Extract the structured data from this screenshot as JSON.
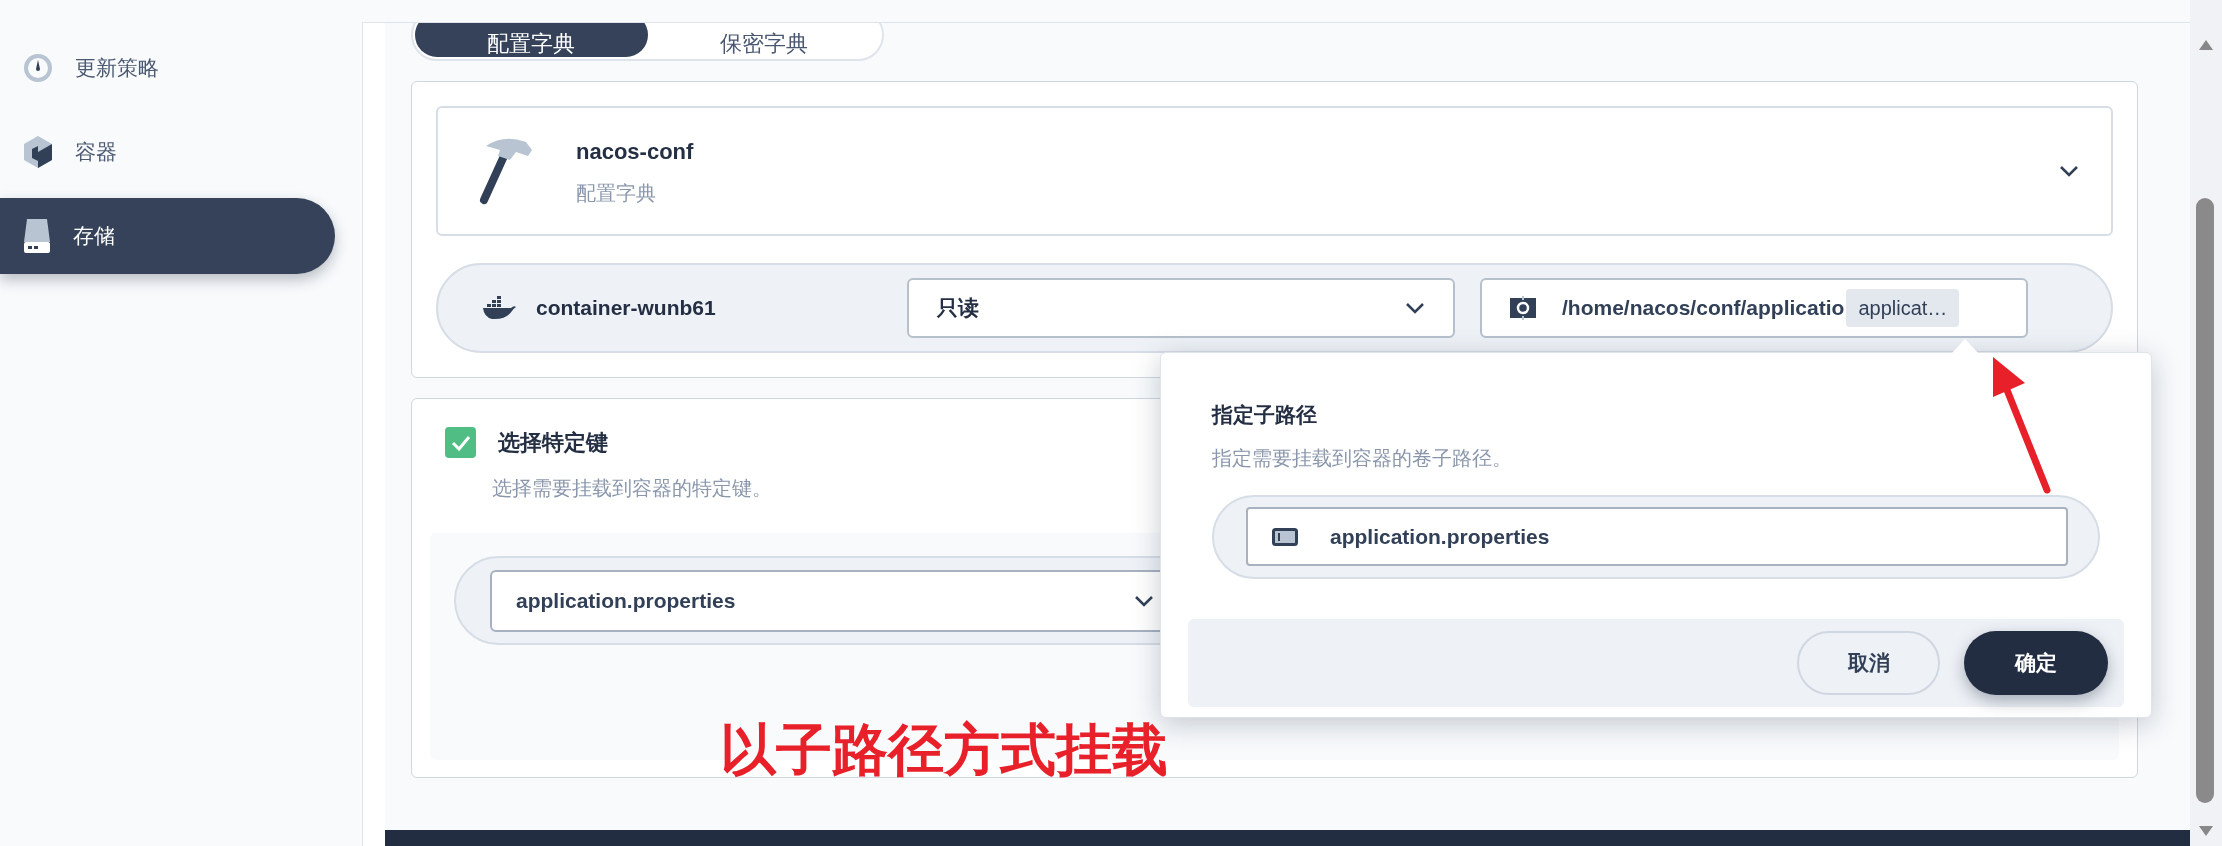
{
  "sidebar": {
    "items": [
      {
        "label": "更新策略",
        "selected": false
      },
      {
        "label": "容器",
        "selected": false
      },
      {
        "label": "存储",
        "selected": true
      }
    ]
  },
  "tabs": [
    {
      "label": "配置字典",
      "selected": true
    },
    {
      "label": "保密字典",
      "selected": false
    }
  ],
  "volume": {
    "name": "nacos-conf",
    "type": "配置字典"
  },
  "mount": {
    "container": "container-wunb61",
    "access": "只读",
    "path": "/home/nacos/conf/applicatio",
    "subpath_badge": "applicat…"
  },
  "keys": {
    "checked": true,
    "title": "选择特定键",
    "description": "选择需要挂载到容器的特定键。",
    "selected_key": "application.properties"
  },
  "popover": {
    "title": "指定子路径",
    "description": "指定需要挂载到容器的卷子路径。",
    "value": "application.properties",
    "buttons": [
      {
        "label": "取消",
        "kind": "secondary"
      },
      {
        "label": "确定",
        "kind": "primary"
      }
    ]
  },
  "annotation": {
    "text": "以子路径方式挂载"
  }
}
